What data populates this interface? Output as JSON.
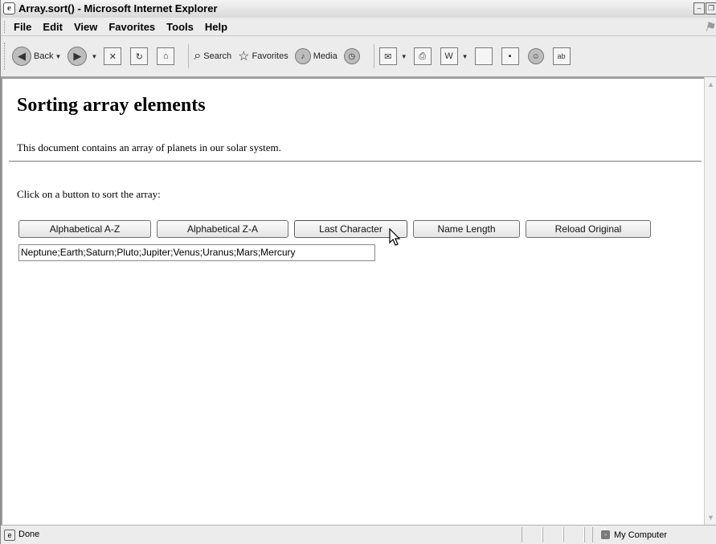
{
  "window": {
    "title": "Array.sort() - Microsoft Internet Explorer",
    "min_glyph": "–",
    "max_glyph": "❐"
  },
  "menu": {
    "items": [
      "File",
      "Edit",
      "View",
      "Favorites",
      "Tools",
      "Help"
    ]
  },
  "toolbar": {
    "back_label": "Back",
    "search_label": "Search",
    "favorites_label": "Favorites",
    "media_label": "Media"
  },
  "page": {
    "heading": "Sorting array elements",
    "intro": "This document contains an array of planets in our solar system.",
    "prompt": "Click on a button to sort the array:",
    "buttons": [
      "Alphabetical A-Z",
      "Alphabetical Z-A",
      "Last Character",
      "Name Length",
      "Reload Original"
    ],
    "output_value": "Neptune;Earth;Saturn;Pluto;Jupiter;Venus;Uranus;Mars;Mercury"
  },
  "status": {
    "text": "Done",
    "zone": "My Computer"
  }
}
